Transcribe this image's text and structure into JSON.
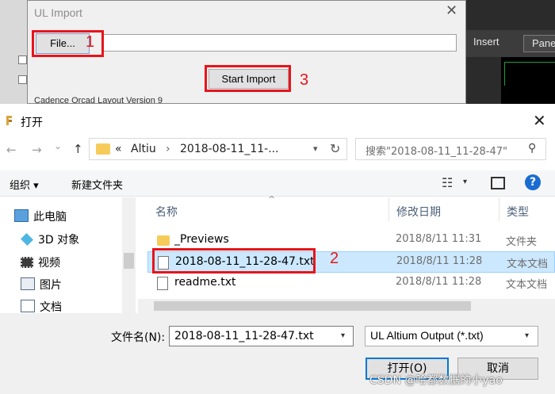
{
  "background_app": {
    "menu_insert": "Insert",
    "menu_panel": "Panels",
    "behind_text": "Cadence Orcad Layout Version 9"
  },
  "ul_dialog": {
    "title": "UL Import",
    "close_glyph": "✕",
    "file_button_label": "File...",
    "path_value": "",
    "start_import_label": "Start Import"
  },
  "annotations": {
    "step1": "1",
    "step2": "2",
    "step3": "3",
    "color": "#e8141a"
  },
  "open_dialog": {
    "title": "打开",
    "close_glyph": "✕",
    "nav": {
      "back_glyph": "←",
      "forward_glyph": "→",
      "recent_glyph": "⌄",
      "up_glyph": "↑"
    },
    "address": {
      "prefix": "«",
      "crumb1": "Altiu",
      "separator": "›",
      "crumb2": "2018-08-11_11-...",
      "refresh_glyph": "↻"
    },
    "search": {
      "placeholder": "搜索\"2018-08-11_11-28-47\"",
      "icon_glyph": "⚲"
    },
    "toolbar": {
      "organize_label": "组织 ▾",
      "new_folder_label": "新建文件夹",
      "view_glyph": "☷",
      "view_arrow": "▾",
      "help_glyph": "?"
    },
    "nav_pane": {
      "items": [
        {
          "label": "此电脑",
          "icon": "computer-icon"
        },
        {
          "label": "3D 对象",
          "icon": "cube-icon"
        },
        {
          "label": "视频",
          "icon": "video-icon"
        },
        {
          "label": "图片",
          "icon": "pictures-icon"
        },
        {
          "label": "文档",
          "icon": "documents-icon"
        }
      ]
    },
    "file_list": {
      "columns": [
        "名称",
        "修改日期",
        "类型"
      ],
      "sort_glyph": "^",
      "rows": [
        {
          "name": "_Previews",
          "date": "2018/8/11 11:31",
          "type": "文件夹",
          "icon": "folder-icon",
          "selected": false
        },
        {
          "name": "2018-08-11_11-28-47.txt",
          "date": "2018/8/11 11:28",
          "type": "文本文档",
          "icon": "text-file-icon",
          "selected": true
        },
        {
          "name": "readme.txt",
          "date": "2018/8/11 11:28",
          "type": "文本文档",
          "icon": "text-file-icon",
          "selected": false
        }
      ]
    },
    "bottom": {
      "filename_label": "文件名(N):",
      "filename_value": "2018-08-11_11-28-47.txt",
      "filetype_value": "UL Altium Output (*.txt)",
      "open_label": "打开(O)",
      "cancel_label": "取消",
      "dropdown_arrow": "▾"
    }
  },
  "watermark": "CSDN @哈都数据的小yao"
}
